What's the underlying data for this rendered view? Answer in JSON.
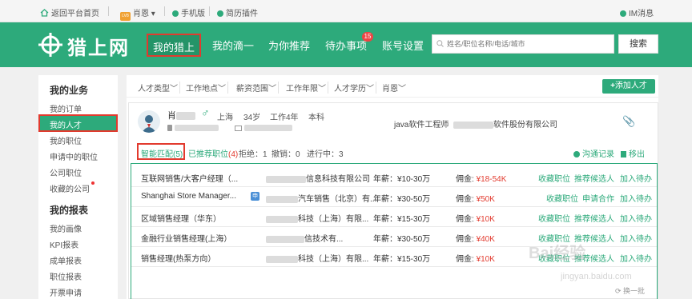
{
  "topbar": {
    "home": "返回平台首页",
    "user": "肖恩",
    "user_level": "LV8",
    "mobile": "手机版",
    "plugin": "简历插件",
    "im": "IM消息"
  },
  "header": {
    "logo": "猎上网",
    "nav": [
      "我的猎上",
      "我的滴一",
      "为你推荐",
      "待办事项",
      "账号设置"
    ],
    "todo_badge": "15",
    "search_placeholder": "姓名/职位名称/电话/城市",
    "search_button": "搜索"
  },
  "sidebar": {
    "business_heading": "我的业务",
    "business_items": [
      "我的订单",
      "我的人才",
      "我的职位",
      "申请中的职位",
      "公司职位",
      "收藏的公司"
    ],
    "reports_heading": "我的报表",
    "report_items": [
      "我的画像",
      "KPI报表",
      "成单报表",
      "职位报表",
      "开票申请"
    ]
  },
  "filters": {
    "items": [
      "人才类型",
      "工作地点",
      "薪资范围",
      "工作年限",
      "人才学历",
      "肖恩"
    ],
    "add_button": "添加人才"
  },
  "candidate": {
    "name": "肖",
    "gender_symbol": "♂",
    "city": "上海",
    "age": "34岁",
    "experience": "工作4年",
    "education": "本科",
    "job_title": "java软件工程师",
    "company_suffix": "软件股份有限公司"
  },
  "tabs": {
    "smart_match": "智能匹配(5)",
    "recommended_label": "已推荐职位",
    "recommended_count": "(4)",
    "rejected": "拒绝：1",
    "withdrawn": "撤销：0",
    "in_progress": "进行中：3",
    "contact_log": "沟通记录",
    "remove": "移出"
  },
  "jobs": [
    {
      "title": "互联网销售/大客户经理（...",
      "company": "信息科技有限公司",
      "salary": "年薪：¥10-30万",
      "fee_label": "佣金:",
      "fee": "¥18-54K",
      "actions": [
        "收藏职位",
        "推荐候选人",
        "加入待办"
      ]
    },
    {
      "title": "Shanghai Store Manager...",
      "chip": "申",
      "company": "汽车销售（北京）有...",
      "salary": "年薪：¥30-50万",
      "fee_label": "佣金:",
      "fee": "¥50K",
      "actions": [
        "收藏职位",
        "申请合作",
        "加入待办"
      ]
    },
    {
      "title": "区域销售经理（华东）",
      "company": "科技（上海）有限...",
      "salary": "年薪：¥15-30万",
      "fee_label": "佣金:",
      "fee": "¥10K",
      "actions": [
        "收藏职位",
        "推荐候选人",
        "加入待办"
      ]
    },
    {
      "title": "金融行业销售经理(上海）",
      "company": "信技术有...",
      "salary": "年薪：¥30-50万",
      "fee_label": "佣金:",
      "fee": "¥40K",
      "actions": [
        "收藏职位",
        "推荐候选人",
        "加入待办"
      ]
    },
    {
      "title": "销售经理(热泵方向）",
      "company": "科技（上海）有限...",
      "salary": "年薪：¥15-30万",
      "fee_label": "佣金:",
      "fee": "¥10K",
      "actions": [
        "收藏职位",
        "推荐候选人",
        "加入待办"
      ]
    }
  ],
  "pager": "换一批",
  "watermark": "Bai经验",
  "watermark_url": "jingyan.baidu.com",
  "colors": {
    "brand_green": "#2daa7b",
    "highlight_red": "#e23a2e"
  }
}
